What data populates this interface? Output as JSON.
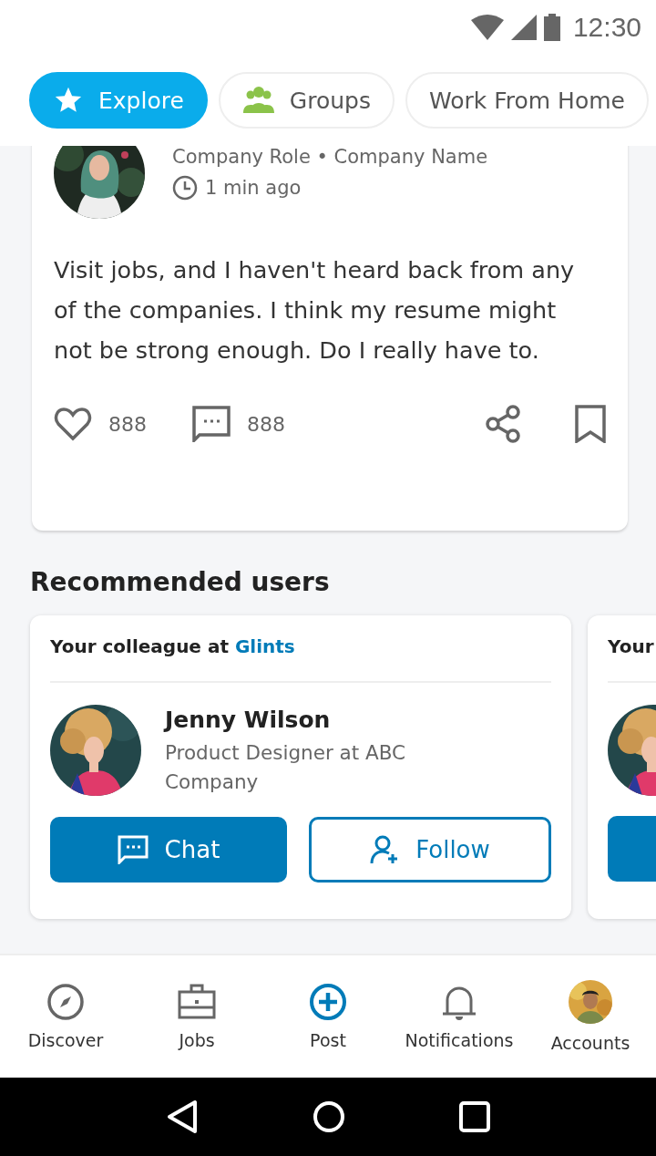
{
  "status_bar": {
    "time": "12:30"
  },
  "chips": [
    {
      "label": "Explore",
      "selected": true
    },
    {
      "label": "Groups",
      "selected": false
    },
    {
      "label": "Work From Home",
      "selected": false
    }
  ],
  "post": {
    "meta": "Company Role • Company Name",
    "time": "1 min ago",
    "body": "Visit jobs, and I haven't heard back from any of the companies. I think my resume might not be strong enough. Do I really have to.",
    "likes": "888",
    "comments": "888",
    "bookmarked": false
  },
  "recommended": {
    "title": "Recommended users",
    "users": [
      {
        "header": "Your colleague at",
        "company": "Glints",
        "name": "Jenny Wilson",
        "role": "Product Designer at ABC Company",
        "chat": "Chat",
        "follow": "Follow"
      },
      {
        "header": "Your"
      }
    ]
  },
  "bottom_nav": [
    {
      "label": "Discover",
      "selected": false
    },
    {
      "label": "Jobs",
      "selected": false
    },
    {
      "label": "Post",
      "selected": true
    },
    {
      "label": "Notifications",
      "selected": false
    },
    {
      "label": "Accounts",
      "selected": false
    }
  ]
}
